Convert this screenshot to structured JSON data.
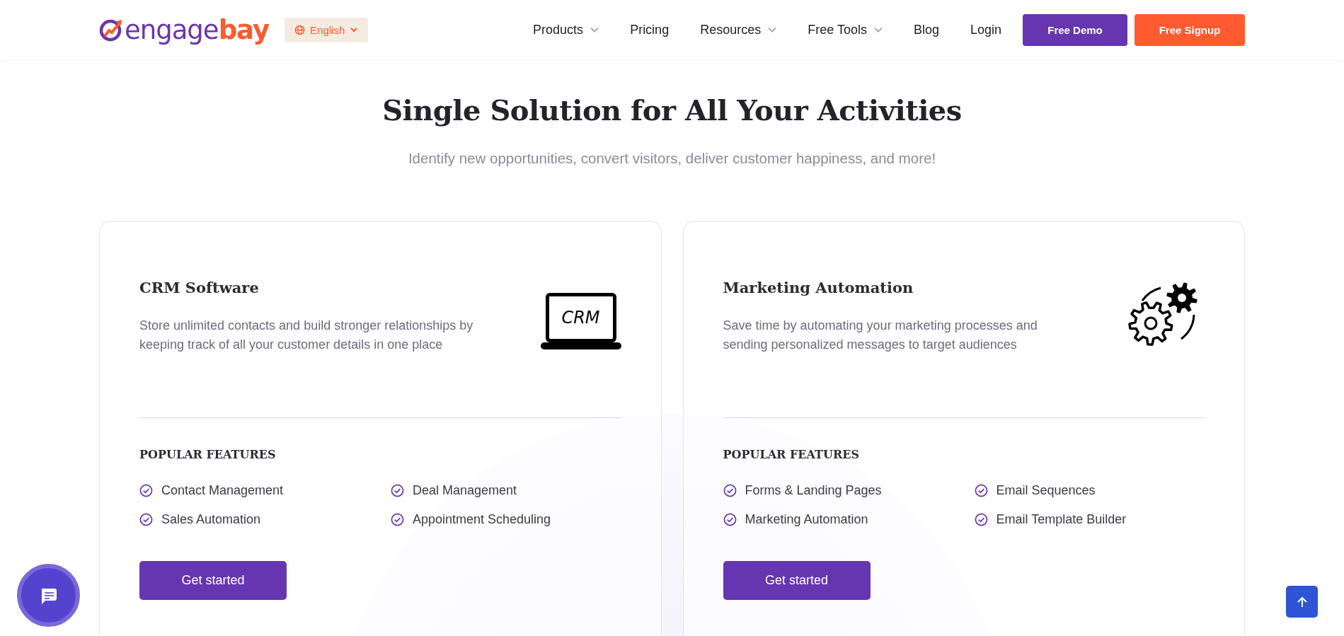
{
  "header": {
    "logo": {
      "first": "engage",
      "second": "bay"
    },
    "language": {
      "label": "English"
    },
    "nav": [
      {
        "label": "Products",
        "dropdown": true
      },
      {
        "label": "Pricing",
        "dropdown": false
      },
      {
        "label": "Resources",
        "dropdown": true
      },
      {
        "label": "Free Tools",
        "dropdown": true
      },
      {
        "label": "Blog",
        "dropdown": false
      },
      {
        "label": "Login",
        "dropdown": false
      }
    ],
    "buttons": [
      {
        "label": "Free Demo",
        "kind": "primary"
      },
      {
        "label": "Free Signup",
        "kind": "accent"
      }
    ]
  },
  "section": {
    "title": "Single Solution for All Your Activities",
    "subtitle": "Identify new opportunities, convert visitors, deliver customer happiness, and more!"
  },
  "cards": [
    {
      "title": "CRM Software",
      "description": "Store unlimited contacts and build stronger relationships by keeping track of all your customer details in one place",
      "icon": {
        "kind": "laptop",
        "label": "CRM"
      },
      "features_heading": "POPULAR FEATURES",
      "features": [
        "Contact Management",
        "Deal Management",
        "Sales Automation",
        "Appointment Scheduling"
      ],
      "button": "Get started"
    },
    {
      "title": "Marketing Automation",
      "description": "Save time by automating your marketing processes and sending personalized messages to target audiences",
      "icon": {
        "kind": "gears"
      },
      "features_heading": "POPULAR FEATURES",
      "features": [
        "Forms & Landing Pages",
        "Email Sequences",
        "Marketing Automation",
        "Email Template Builder"
      ],
      "button": "Get started"
    }
  ]
}
